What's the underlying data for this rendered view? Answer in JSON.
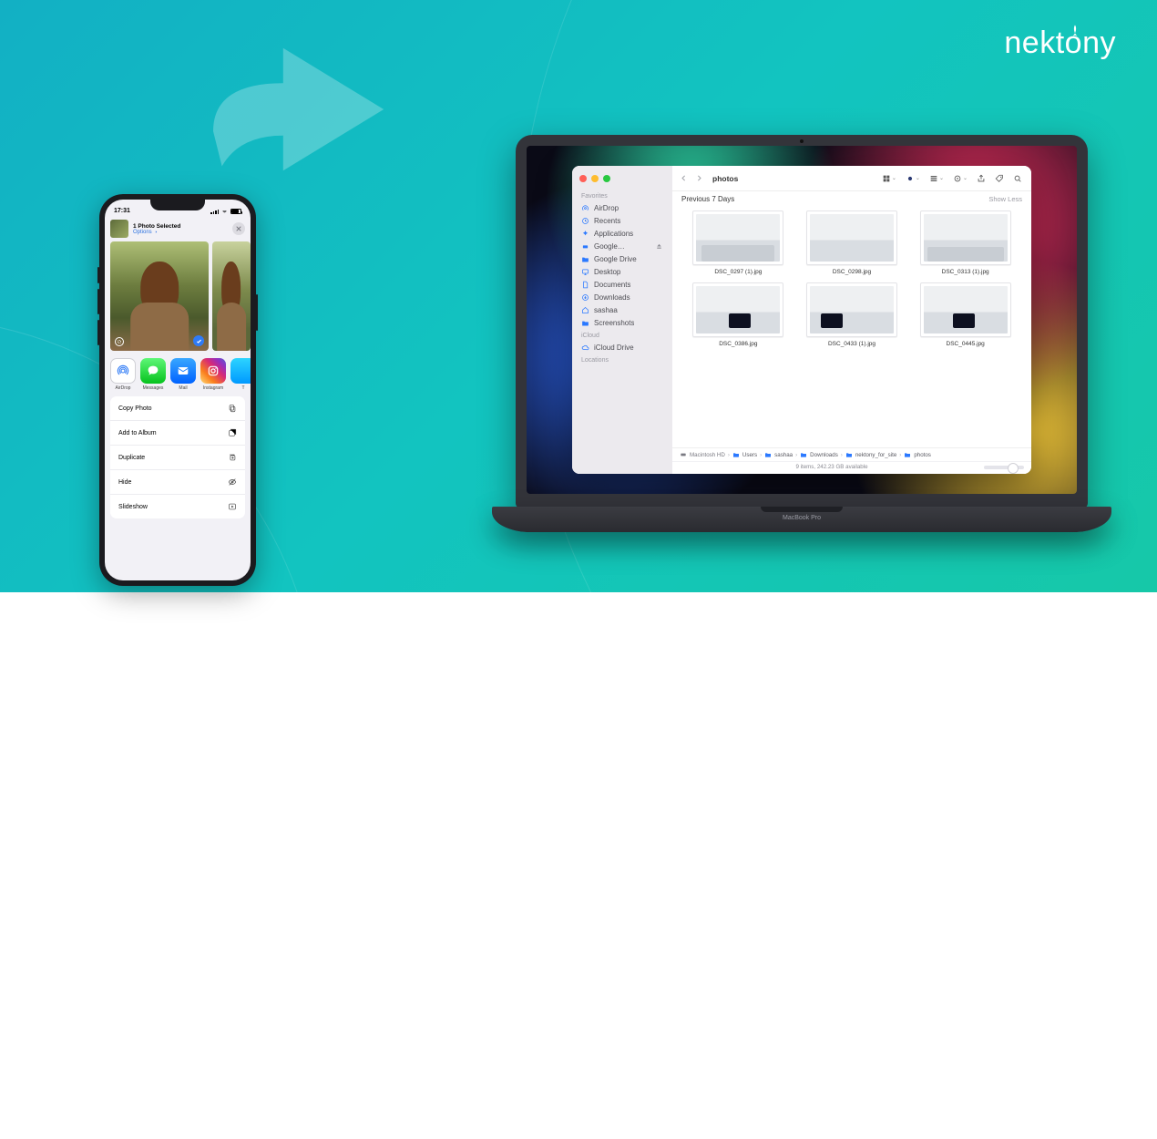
{
  "brand": {
    "name": "nektony"
  },
  "iphone": {
    "status": {
      "time": "17:31"
    },
    "share": {
      "title": "1 Photo Selected",
      "options_label": "Options",
      "close_aria": "Close"
    },
    "apps": {
      "airdrop": "AirDrop",
      "messages": "Messages",
      "mail": "Mail",
      "instagram": "Instagram",
      "extra": "T"
    },
    "actions": {
      "copy": "Copy Photo",
      "add": "Add to Album",
      "dup": "Duplicate",
      "hide": "Hide",
      "slideshow": "Slideshow"
    }
  },
  "macbook": {
    "model": "MacBook Pro"
  },
  "finder": {
    "title": "photos",
    "sidebar": {
      "sections": {
        "favorites": "Favorites",
        "icloud": "iCloud",
        "locations": "Locations"
      },
      "items": {
        "airdrop": "AirDrop",
        "recents": "Recents",
        "applications": "Applications",
        "google_eject": "Google…",
        "googledrive": "Google Drive",
        "desktop": "Desktop",
        "documents": "Documents",
        "downloads": "Downloads",
        "sashaa": "sashaa",
        "screenshots": "Screenshots",
        "iclouddrive": "iCloud Drive"
      }
    },
    "section_header": "Previous 7 Days",
    "show_less": "Show Less",
    "files": [
      "DSC_0297 (1).jpg",
      "DSC_0298.jpg",
      "DSC_0313 (1).jpg",
      "DSC_0386.jpg",
      "DSC_0433 (1).jpg",
      "DSC_0445.jpg"
    ],
    "path": {
      "hd": "Macintosh HD",
      "users": "Users",
      "user": "sashaa",
      "downloads": "Downloads",
      "site": "nektony_for_site",
      "photos": "photos"
    },
    "status": "9 items, 242.23 GB available"
  }
}
